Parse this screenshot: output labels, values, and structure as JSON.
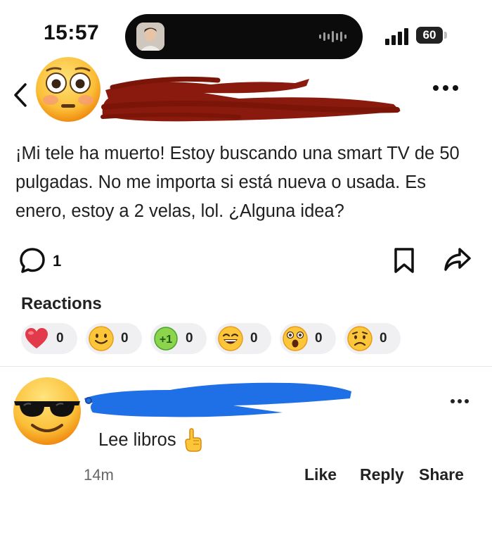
{
  "status_bar": {
    "time": "15:57",
    "battery": "60",
    "icons": [
      "live-activity-avatar",
      "audio-waveform-icon",
      "cellular-signal-icon",
      "battery-icon"
    ]
  },
  "post": {
    "author_emoji": "flushed-face-emoji",
    "author_name_redacted": true,
    "text": "¡Mi tele ha muerto! Estoy buscando una smart TV de 50 pulgadas. No me importa si está nueva o usada. Es enero, estoy a 2 velas, lol. ¿Alguna idea?",
    "comment_count": "1",
    "more_icon": "more-horizontal-icon",
    "redaction_color": "#8b1a0e"
  },
  "reactions": {
    "title": "Reactions",
    "items": [
      {
        "name": "heart",
        "count": "0"
      },
      {
        "name": "smile",
        "count": "0"
      },
      {
        "name": "plus-one",
        "count": "0"
      },
      {
        "name": "grin",
        "count": "0"
      },
      {
        "name": "surprised",
        "count": "0"
      },
      {
        "name": "worried",
        "count": "0"
      }
    ]
  },
  "comment": {
    "author_emoji": "sunglasses-face-emoji",
    "author_name_redacted": true,
    "redaction_color": "#1f6fe6",
    "text": "Lee libros",
    "emoji": "pointing-up-hand-emoji",
    "time": "14m",
    "actions": {
      "like": "Like",
      "reply": "Reply",
      "share": "Share"
    }
  }
}
